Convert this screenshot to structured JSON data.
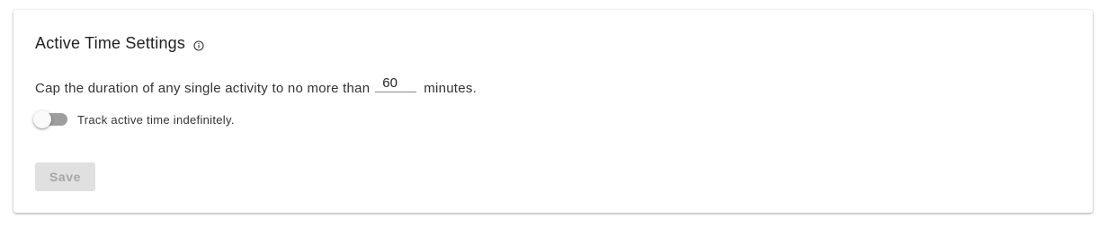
{
  "card": {
    "title": "Active Time Settings",
    "info_icon": "info-circle-icon"
  },
  "cap_setting": {
    "prefix": "Cap the duration of any single activity to no more than",
    "minutes_value": "60",
    "suffix": "minutes."
  },
  "track_toggle": {
    "label": "Track active time indefinitely.",
    "checked": false
  },
  "actions": {
    "save_label": "Save",
    "save_disabled": true
  },
  "colors": {
    "toggle_track_off": "#9e9e9e",
    "save_disabled_bg": "#e0e0e0",
    "save_disabled_text": "#a6a6a6"
  }
}
